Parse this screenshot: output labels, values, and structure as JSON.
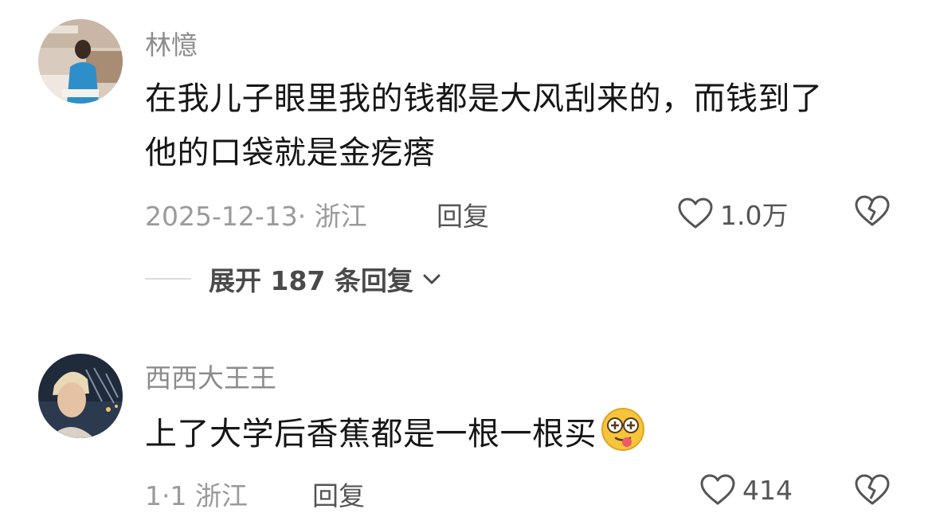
{
  "comments": [
    {
      "username": "林憶",
      "text_line1": "在我儿子眼里我的钱都是大风刮来的，而钱到了",
      "text_line2": "他的口袋就是金疙瘩",
      "date_location": "2025-12-13· 浙江",
      "reply_label": "回复",
      "like_count": "1.0万",
      "expand_label": "展开 187 条回复"
    },
    {
      "username": "西西大王王",
      "text": "上了大学后香蕉都是一根一根买",
      "emoji": "dizzy-tongue-emoji",
      "date_location": "1·1 浙江",
      "reply_label": "回复",
      "like_count": "414"
    }
  ],
  "icons": {
    "like": "heart-outline-icon",
    "dislike": "broken-heart-icon",
    "expand": "chevron-down-icon"
  },
  "colors": {
    "username": "#8c8c8c",
    "text": "#161616",
    "meta": "#9a9a9a"
  }
}
